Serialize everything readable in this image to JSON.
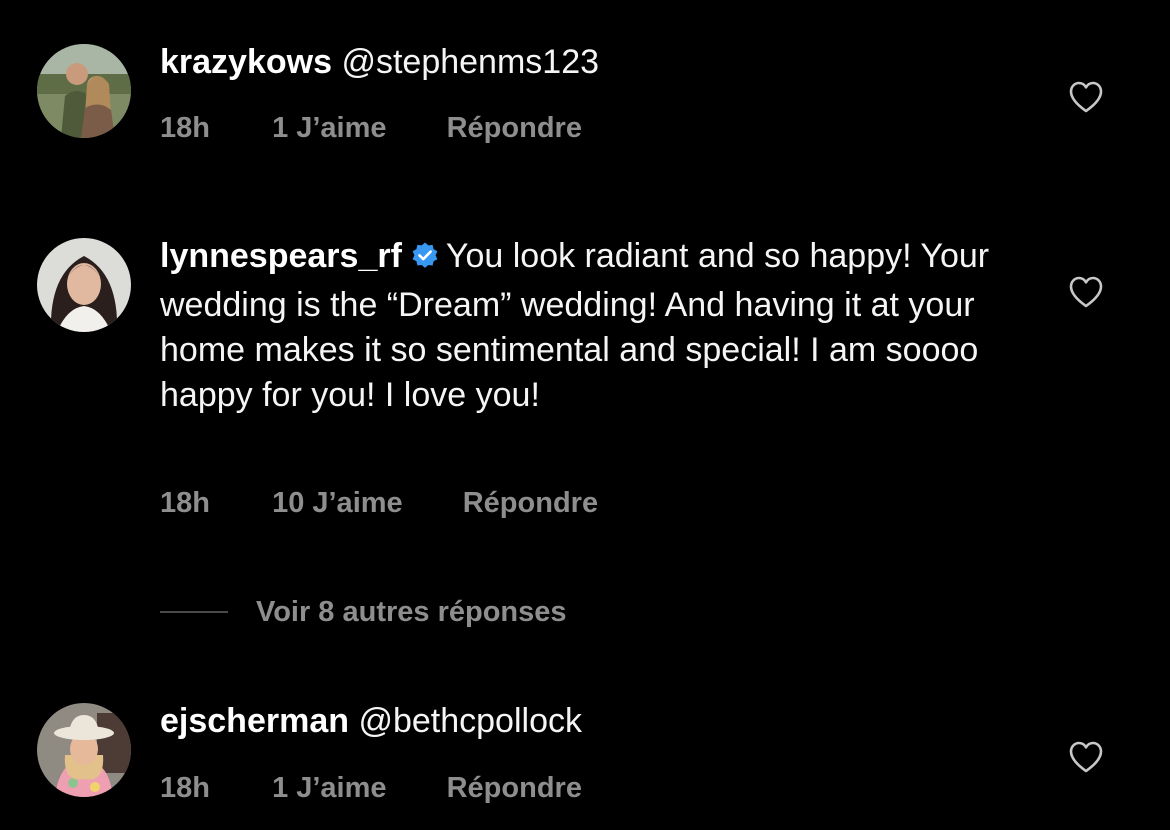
{
  "comments": [
    {
      "username": "krazykows",
      "text": "@stephenms123",
      "time": "18h",
      "likes": "1 J’aime",
      "reply": "Répondre",
      "verified": false
    },
    {
      "username": "lynnespears_rf",
      "text": "You look radiant and so happy! Your wedding is the “Dream” wedding! And having it at your home makes it so sentimental and special! I am soooo happy for you! I love you!",
      "time": "18h",
      "likes": "10 J’aime",
      "reply": "Répondre",
      "verified": true
    },
    {
      "username": "ejscherman",
      "text": "@bethcpollock",
      "time": "18h",
      "likes": "1 J’aime",
      "reply": "Répondre",
      "verified": false
    }
  ],
  "view_replies": "Voir 8 autres réponses",
  "icons": {
    "like": "heart-outline-icon",
    "verified": "verified-badge-icon"
  },
  "colors": {
    "background": "#000000",
    "text": "#ffffff",
    "secondary": "#8e8e8e",
    "verified": "#3897f0"
  }
}
